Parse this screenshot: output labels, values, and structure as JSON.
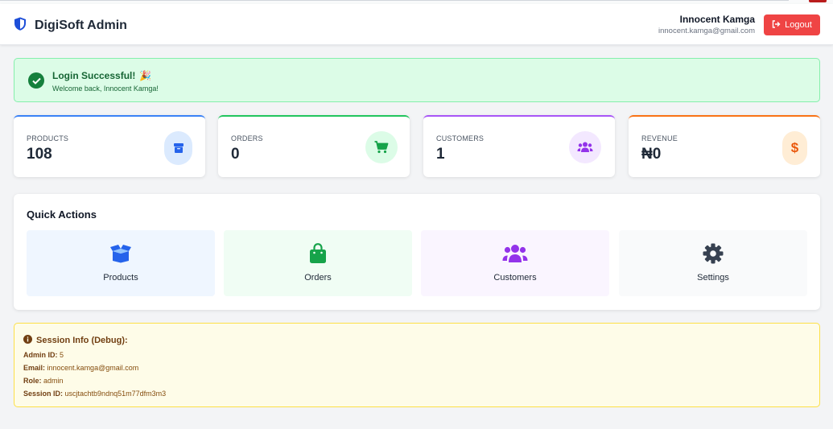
{
  "header": {
    "brand_title": "DigiSoft Admin",
    "user_name": "Innocent Kamga",
    "user_email": "innocent.kamga@gmail.com",
    "logout_label": "Logout"
  },
  "alert": {
    "title": "Login Successful!",
    "emoji": "🎉",
    "message": "Welcome back, Innocent Kamga!"
  },
  "stats": [
    {
      "label": "PRODUCTS",
      "value": "108",
      "color": "#3b82f6",
      "icon": "box-icon"
    },
    {
      "label": "ORDERS",
      "value": "0",
      "color": "#22c55e",
      "icon": "cart-icon"
    },
    {
      "label": "CUSTOMERS",
      "value": "1",
      "color": "#a855f7",
      "icon": "users-icon"
    },
    {
      "label": "REVENUE",
      "value": "₦0",
      "color": "#f97316",
      "icon": "dollar-icon"
    }
  ],
  "quick_actions": {
    "title": "Quick Actions",
    "items": [
      {
        "label": "Products",
        "icon": "box-open-icon"
      },
      {
        "label": "Orders",
        "icon": "shopping-bag-icon"
      },
      {
        "label": "Customers",
        "icon": "users-icon"
      },
      {
        "label": "Settings",
        "icon": "gear-icon"
      }
    ]
  },
  "debug": {
    "title": "Session Info (Debug):",
    "rows": [
      {
        "key": "Admin ID:",
        "value": "5"
      },
      {
        "key": "Email:",
        "value": "innocent.kamga@gmail.com"
      },
      {
        "key": "Role:",
        "value": "admin"
      },
      {
        "key": "Session ID:",
        "value": "uscjtachtb9ndnq51m77dfm3m3"
      }
    ]
  },
  "colors": {
    "logout": "#ef4444",
    "success": "#166534",
    "products": "#3b82f6",
    "orders": "#22c55e",
    "customers": "#a855f7",
    "revenue": "#f97316"
  }
}
